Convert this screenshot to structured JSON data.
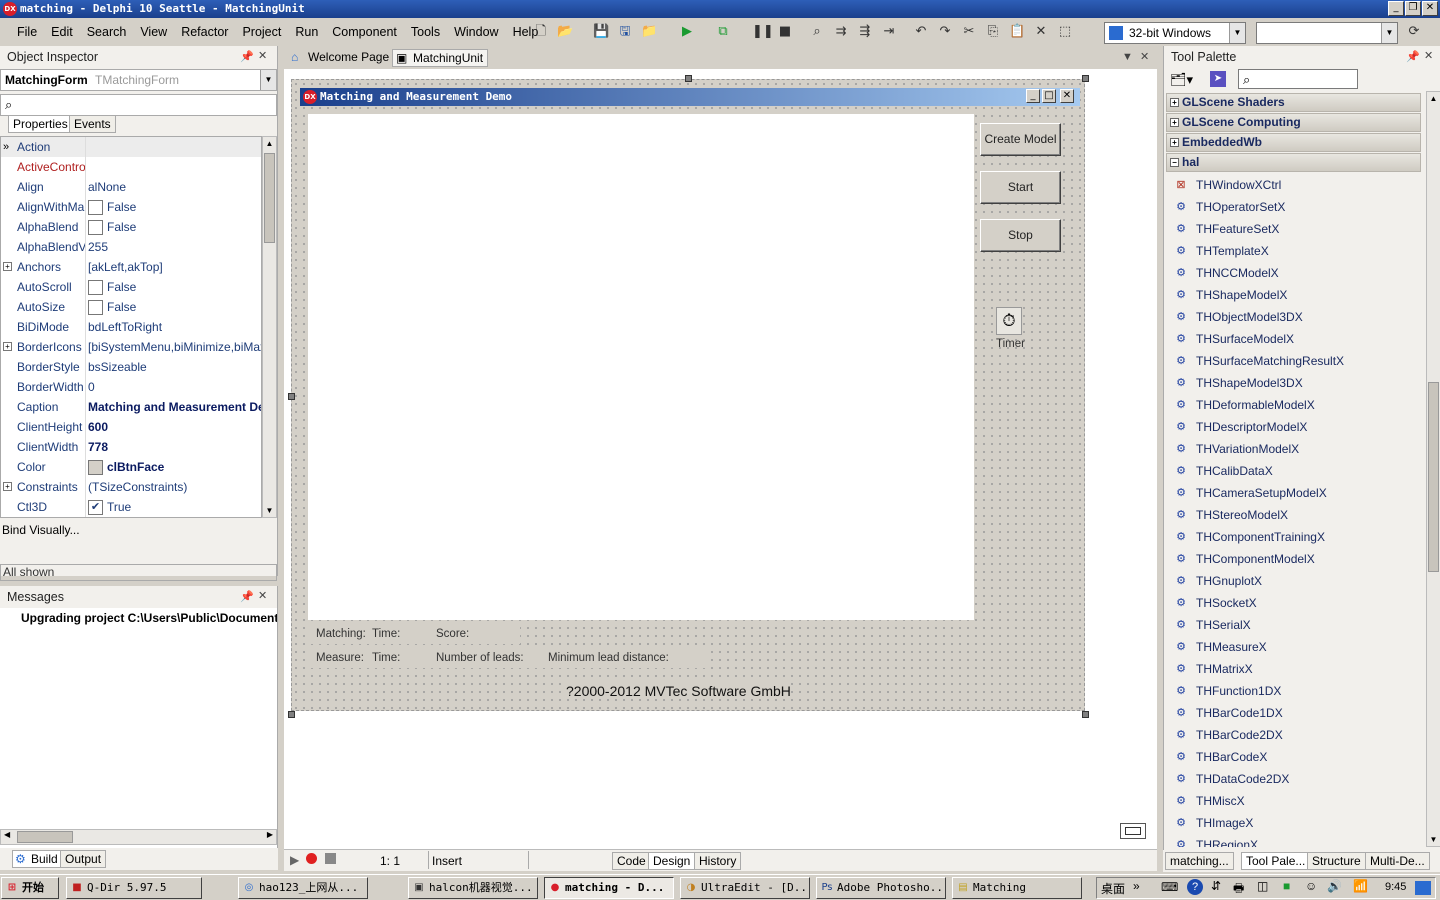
{
  "window": {
    "title": "matching - Delphi 10 Seattle - MatchingUnit",
    "logo": "DX"
  },
  "menu": [
    "File",
    "Edit",
    "Search",
    "View",
    "Refactor",
    "Project",
    "Run",
    "Component",
    "Tools",
    "Window",
    "Help"
  ],
  "toolbar": {
    "platform": "32-bit Windows"
  },
  "object_inspector": {
    "title": "Object Inspector",
    "selected_name": "MatchingForm",
    "selected_type": "TMatchingForm",
    "tabs": [
      "Properties",
      "Events"
    ],
    "rows": [
      {
        "name": "Action",
        "value": ""
      },
      {
        "name": "ActiveControl",
        "value": ""
      },
      {
        "name": "Align",
        "value": "alNone"
      },
      {
        "name": "AlignWithMargins",
        "value": "False",
        "check": ""
      },
      {
        "name": "AlphaBlend",
        "value": "False",
        "check": ""
      },
      {
        "name": "AlphaBlendValue",
        "value": "255"
      },
      {
        "name": "Anchors",
        "value": "[akLeft,akTop]",
        "expand": "+"
      },
      {
        "name": "AutoScroll",
        "value": "False",
        "check": ""
      },
      {
        "name": "AutoSize",
        "value": "False",
        "check": ""
      },
      {
        "name": "BiDiMode",
        "value": "bdLeftToRight"
      },
      {
        "name": "BorderIcons",
        "value": "[biSystemMenu,biMinimize,biMaximize]",
        "expand": "+"
      },
      {
        "name": "BorderStyle",
        "value": "bsSizeable"
      },
      {
        "name": "BorderWidth",
        "value": "0"
      },
      {
        "name": "Caption",
        "value": "Matching and Measurement Demo",
        "bold": true
      },
      {
        "name": "ClientHeight",
        "value": "600",
        "bold": true
      },
      {
        "name": "ClientWidth",
        "value": "778",
        "bold": true
      },
      {
        "name": "Color",
        "value": "clBtnFace",
        "bold": true,
        "swatch": true
      },
      {
        "name": "Constraints",
        "value": "(TSizeConstraints)",
        "expand": "+"
      },
      {
        "name": "Ctl3D",
        "value": "True",
        "check": "✔"
      }
    ],
    "bind_visually": "Bind Visually...",
    "filter": "All shown"
  },
  "messages": {
    "title": "Messages",
    "text": "Upgrading project C:\\Users\\Public\\Documents"
  },
  "bottom_tabs": [
    "Build",
    "Output"
  ],
  "editor_tabs": [
    "Welcome Page",
    "MatchingUnit"
  ],
  "form": {
    "caption": "Matching and Measurement Demo",
    "buttons": [
      "Create Model",
      "Start",
      "Stop"
    ],
    "timer_label": "Timer",
    "labels": {
      "matching": "Matching:",
      "time1": "Time:",
      "score": "Score:",
      "measure": "Measure:",
      "time2": "Time:",
      "leads": "Number of leads:",
      "min_lead": "Minimum lead distance:"
    },
    "copyright": "?2000-2012 MVTec Software GmbH"
  },
  "statusbar": {
    "position": "1:  1",
    "mode": "Insert",
    "tabs": [
      "Code",
      "Design",
      "History"
    ]
  },
  "tool_palette": {
    "title": "Tool Palette",
    "categories": [
      {
        "label": "GLScene Shaders",
        "sign": "+"
      },
      {
        "label": "GLScene Computing",
        "sign": "+"
      },
      {
        "label": "EmbeddedWb",
        "sign": "+"
      },
      {
        "label": "hal",
        "sign": "−"
      }
    ],
    "items": [
      "THWindowXCtrl",
      "THOperatorSetX",
      "THFeatureSetX",
      "THTemplateX",
      "THNCCModelX",
      "THShapeModelX",
      "THObjectModel3DX",
      "THSurfaceModelX",
      "THSurfaceMatchingResultX",
      "THShapeModel3DX",
      "THDeformableModelX",
      "THDescriptorModelX",
      "THVariationModelX",
      "THCalibDataX",
      "THCameraSetupModelX",
      "THStereoModelX",
      "THComponentTrainingX",
      "THComponentModelX",
      "THGnuplotX",
      "THSocketX",
      "THSerialX",
      "THMeasureX",
      "THMatrixX",
      "THFunction1DX",
      "THBarCode1DX",
      "THBarCode2DX",
      "THBarCodeX",
      "THDataCode2DX",
      "THMiscX",
      "THImageX",
      "THRegionX"
    ],
    "bottom_tabs": [
      "matching...",
      "Tool Pale...",
      "Structure",
      "Multi-De..."
    ]
  },
  "taskbar": {
    "start": "开始",
    "buttons": [
      "Q-Dir 5.97.5",
      "hao123_上网从...",
      "halcon机器视觉...",
      "matching - D...",
      "UltraEdit - [D...",
      "Adobe Photosho...",
      "Matching"
    ],
    "desktop": "桌面",
    "clock": "9:45"
  },
  "colors": {
    "titlebar": "#1a3f8c",
    "face": "#d4d0c8",
    "accent": "#d81e2a"
  }
}
